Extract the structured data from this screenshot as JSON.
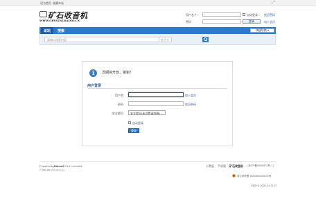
{
  "topbar": {
    "set_home": "设为首页",
    "bookmark": "收藏本站"
  },
  "logo": {
    "cn": "矿石收音机",
    "en": "WWW.CRYSTALRADIO.CN"
  },
  "mini_login": {
    "username_label": "用户名 ▾",
    "auto_login": "自动登录",
    "find_password": "找回密码",
    "password_label": "密码",
    "login_button": "登录",
    "register": "加入会员"
  },
  "nav": {
    "tabs": [
      {
        "label": "论坛"
      },
      {
        "label": "搜索"
      }
    ],
    "quick_nav": "快捷导航 ▾"
  },
  "search": {
    "placeholder": "请输入搜索内容",
    "type": "帖子 ▾"
  },
  "panel": {
    "message": "近期将开放，谢谢！",
    "section_title": "用户登录",
    "username_label": "用户名:",
    "register_link": "加入会员",
    "password_label": "密码:",
    "find_password": "找回密码",
    "security_label": "安全提问:",
    "security_value": "安全提问(未设置请忽略)",
    "auto_login": "自动登录",
    "login_button": "登录"
  },
  "footer": {
    "powered_prefix": "Powered by",
    "powered_name": "Discuz!",
    "powered_version": "X3.4 Licensed",
    "copyright": "© 2001-2013 Comsenz Inc.",
    "links": [
      "小黑屋",
      "手机版"
    ],
    "site_name": "矿石收音机",
    "icp": "( 浙ICP备05008122号-1 )",
    "police": "浙公网安备 33010602000075号",
    "gmt": "GMT+8, 2020-3-4 01:27"
  },
  "colors": {
    "accent": "#2b7acd",
    "link": "#3366aa"
  }
}
